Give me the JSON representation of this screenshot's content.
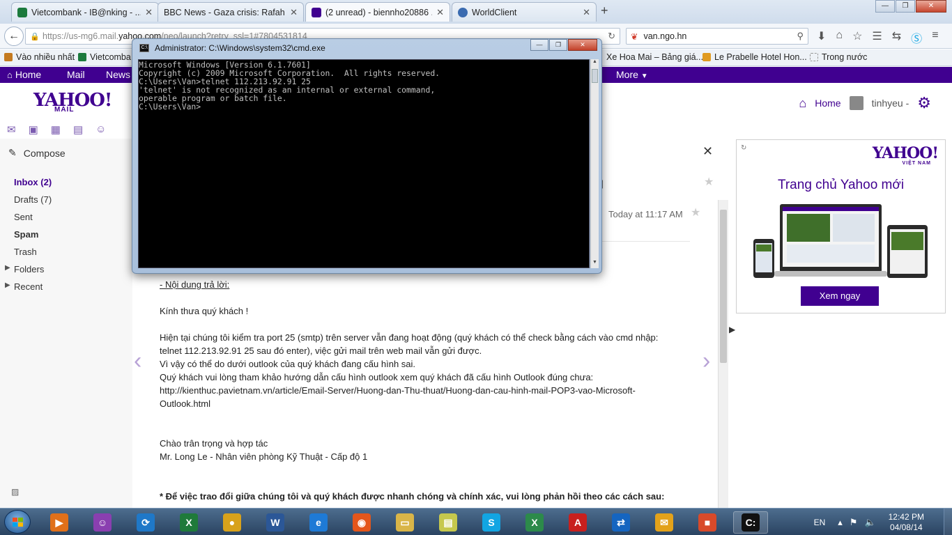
{
  "browser": {
    "tabs": [
      {
        "label": "Vietcombank - IB@nking - ...",
        "color": "#1c7a3d"
      },
      {
        "label": "BBC News - Gaza crisis: Rafah s...",
        "color": "#b00000"
      },
      {
        "label": "(2 unread) - biennho20886 ...",
        "color": "#400090"
      },
      {
        "label": "WorldClient",
        "color": "#3a6bb0"
      }
    ],
    "url_prefix": "https://us-mg6.mail.",
    "url_domain": "yahoo.com",
    "url_suffix": "/neo/launch?retry_ssl=1#7804531814",
    "search_value": "van.ngo.hn",
    "bookmarks": [
      {
        "label": "Vào nhiều nhất",
        "color": "#c47a20"
      },
      {
        "label": "Vietcomba",
        "color": "#1c7a3d"
      },
      {
        "label": "Xe Hoa Mai – Bảng giá...",
        "color": "#3a6bb0"
      },
      {
        "label": "Le Prabelle Hotel Hon...",
        "color": "#e09a20"
      },
      {
        "label": "Trong nước",
        "color": "#bbbbbb"
      }
    ]
  },
  "yahoo_bar": {
    "home": "Home",
    "mail": "Mail",
    "news": "News",
    "more": "More"
  },
  "header": {
    "logo": "YAHOO!",
    "logo_sub": "MAIL",
    "home": "Home",
    "user": "tinhyeu -",
    "app_icons": [
      "mail-icon",
      "contacts-icon",
      "calendar-icon",
      "notepad-icon",
      "messenger-icon"
    ]
  },
  "sidebar": {
    "compose": "Compose",
    "folders": [
      {
        "label": "Inbox (2)"
      },
      {
        "label": "Drafts (7)"
      },
      {
        "label": "Sent"
      },
      {
        "label": "Spam"
      },
      {
        "label": "Trash"
      },
      {
        "label": "Folders"
      },
      {
        "label": "Recent"
      }
    ]
  },
  "message": {
    "date": "Today at 11:17 AM",
    "bracket": "]",
    "lines": [
      {
        "text": "- Nội dung trả lời:",
        "style": "u"
      },
      {
        "text": "Kính thưa quý khách !",
        "style": ""
      },
      {
        "text": "Hiện tại chúng tôi kiểm tra port 25 (smtp) trên server vẫn đang hoạt động (quý khách có thể check bằng cách vào cmd nhập:",
        "style": ""
      },
      {
        "text": "telnet 112.213.92.91 25 sau đó enter), việc gửi mail trên web mail vẫn gửi được.",
        "style": ""
      },
      {
        "text": "Vì vậy có thể do dưới outlook của quý khách đang cấu hình sai.",
        "style": ""
      },
      {
        "text": "Quý khách vui lòng tham khảo hướng dẫn cấu hình outlook xem quý khách đã cấu hình Outlook đúng chưa:",
        "style": ""
      },
      {
        "text": "http://kienthuc.pavietnam.vn/article/Email-Server/Huong-dan-Thu-thuat/Huong-dan-cau-hinh-mail-POP3-vao-Microsoft-",
        "style": ""
      },
      {
        "text": "Outlook.html",
        "style": ""
      },
      {
        "text": "Chào trân trọng và hợp tác",
        "style": ""
      },
      {
        "text": "Mr. Long Le - Nhân viên phòng Kỹ Thuật - Cấp độ 1",
        "style": ""
      },
      {
        "text": "* Để việc trao đổi giữa chúng tôi và quý khách được nhanh chóng và chính xác, vui lòng phản hồi theo các cách sau:",
        "style": "b"
      }
    ]
  },
  "ad": {
    "logo": "YAHOO!",
    "logo_sub": "VIỆT NAM",
    "headline": "Trang chủ Yahoo mới",
    "button": "Xem ngay"
  },
  "cmd": {
    "title": "Administrator: C:\\Windows\\system32\\cmd.exe",
    "lines": [
      "Microsoft Windows [Version 6.1.7601]",
      "Copyright (c) 2009 Microsoft Corporation.  All rights reserved.",
      "",
      "C:\\Users\\Van>telnet 112.213.92.91 25",
      "'telnet' is not recognized as an internal or external command,",
      "operable program or batch file.",
      "",
      "C:\\Users\\Van>"
    ]
  },
  "taskbar": {
    "apps": [
      {
        "name": "media-player-icon",
        "glyph": "▶",
        "color": "#e0701a"
      },
      {
        "name": "yahoo-messenger-icon",
        "glyph": "☺",
        "color": "#8a3fb0"
      },
      {
        "name": "downloader-icon",
        "glyph": "⟳",
        "color": "#1f78c8"
      },
      {
        "name": "excel-icon",
        "glyph": "X",
        "color": "#1f7a3a"
      },
      {
        "name": "chrome-icon",
        "glyph": "●",
        "color": "#d8a21b"
      },
      {
        "name": "word-icon",
        "glyph": "W",
        "color": "#2b5797"
      },
      {
        "name": "internet-explorer-icon",
        "glyph": "e",
        "color": "#1e7ad6"
      },
      {
        "name": "firefox-icon",
        "glyph": "◉",
        "color": "#e4561b"
      },
      {
        "name": "file-explorer-icon",
        "glyph": "▭",
        "color": "#d9b548"
      },
      {
        "name": "sticky-notes-icon",
        "glyph": "▤",
        "color": "#c6c84d"
      },
      {
        "name": "skype-icon",
        "glyph": "S",
        "color": "#12a5e3"
      },
      {
        "name": "excel-2-icon",
        "glyph": "X",
        "color": "#2c8a4a"
      },
      {
        "name": "pdf-reader-icon",
        "glyph": "A",
        "color": "#c8201e"
      },
      {
        "name": "teamviewer-icon",
        "glyph": "⇄",
        "color": "#1565c0"
      },
      {
        "name": "outlook-icon",
        "glyph": "✉",
        "color": "#e3a21a"
      },
      {
        "name": "control-panel-icon",
        "glyph": "■",
        "color": "#d84a2a"
      },
      {
        "name": "cmd-taskbar-icon",
        "glyph": "C:",
        "color": "#111111"
      }
    ],
    "lang": "EN",
    "time": "12:42 PM",
    "date": "04/08/14"
  }
}
